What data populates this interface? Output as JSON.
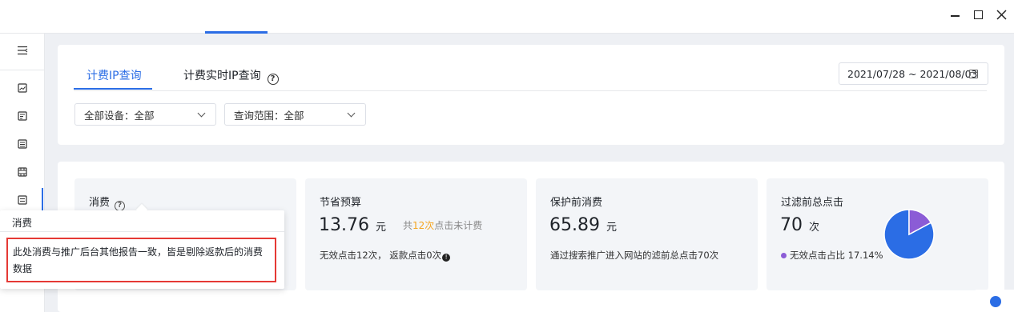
{
  "window": {
    "min_icon": "minimize-icon",
    "max_icon": "maximize-icon",
    "close_icon": "close-icon"
  },
  "sidebar": {
    "toggle_icon": "menu-icon",
    "items": [
      {
        "icon": "image-report-icon"
      },
      {
        "icon": "calendar-report-icon"
      },
      {
        "icon": "list-report-icon"
      },
      {
        "icon": "film-report-icon"
      },
      {
        "icon": "ip-report-icon",
        "active": true
      }
    ]
  },
  "tabs": [
    {
      "label": "计费IP查询",
      "active": true
    },
    {
      "label": "计费实时IP查询",
      "help": "?"
    }
  ],
  "date_range": "2021/07/28 ~ 2021/08/03",
  "filters": {
    "device": "全部设备：全部",
    "scope": "查询范围：全部"
  },
  "cards": {
    "spend": {
      "title": "消费",
      "help": "?"
    },
    "saved_budget": {
      "title": "节省预算",
      "value": "13.76",
      "unit": "元",
      "note_prefix": "共",
      "note_count": "12次",
      "note_suffix": "点击未计费",
      "detail": "无效点击12次， 返款点击0次",
      "info": "!"
    },
    "protected_spend": {
      "title": "保护前消费",
      "value": "65.89",
      "unit": "元",
      "detail": "通过搜索推广进入网站的滤前总点击70次"
    },
    "total_clicks": {
      "title": "过滤前总点击",
      "value": "70",
      "unit": "次",
      "legend": "无效点击占比 17.14%"
    }
  },
  "pie": {
    "invalid_fraction": 0.1714,
    "colors": {
      "invalid": "#8b5cd6",
      "valid": "#2b6de5"
    }
  },
  "tooltip": {
    "title": "消费",
    "body": "此处消费与推广后台其他报告一致，皆是剔除返款后的消费数据"
  },
  "colors": {
    "accent": "#2b6de5",
    "highlight": "#f5a623",
    "alert_border": "#e53935"
  }
}
